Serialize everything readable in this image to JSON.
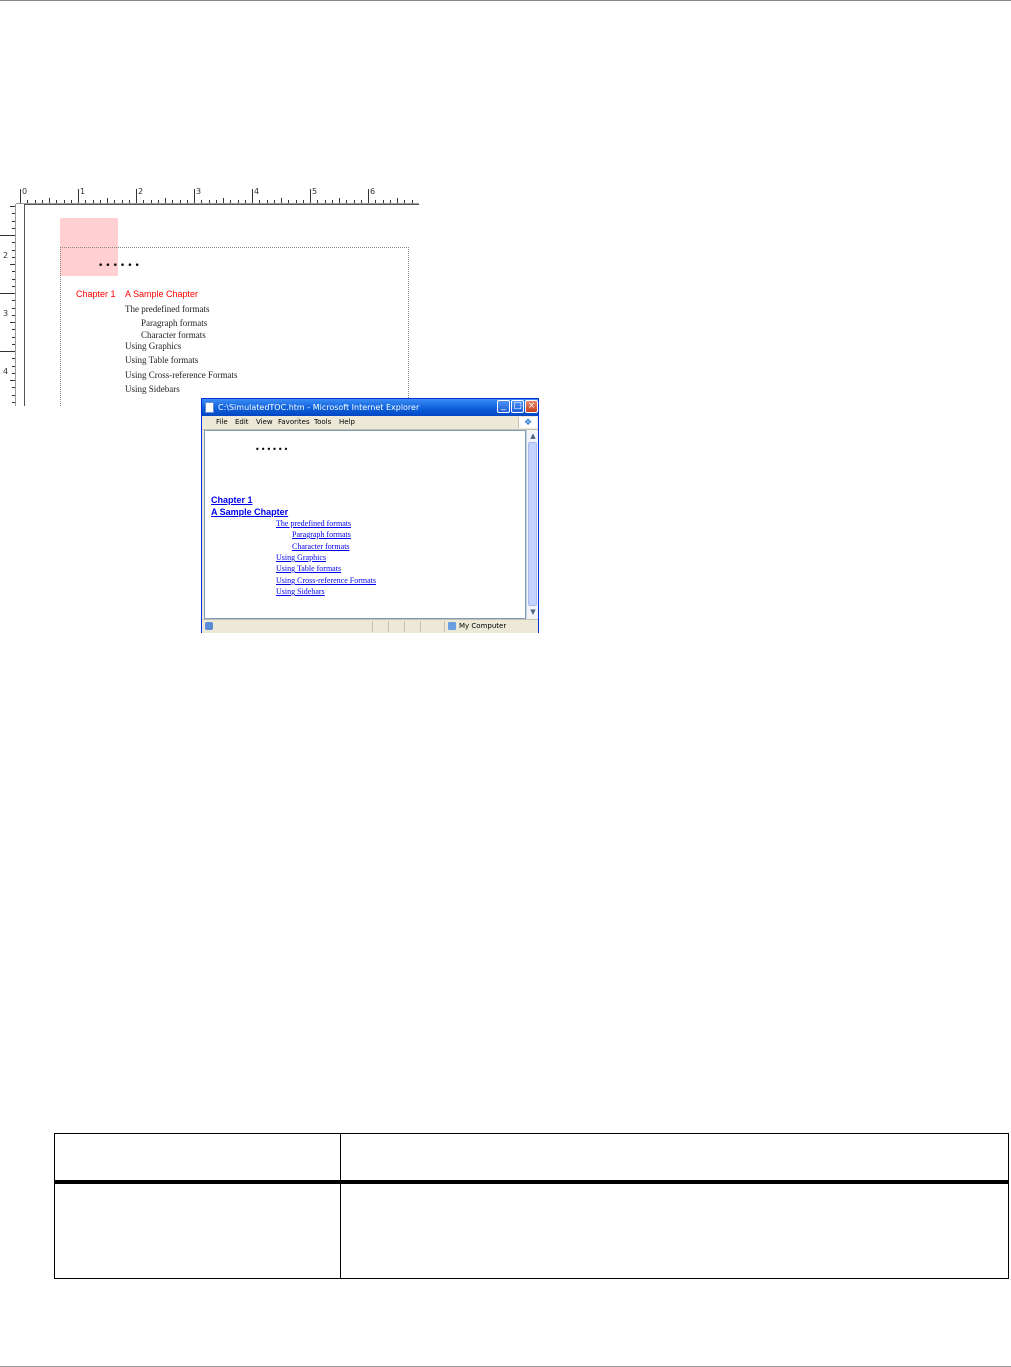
{
  "editor": {
    "ruler_h_numbers": [
      "0",
      "1",
      "2",
      "3",
      "4",
      "5",
      "6"
    ],
    "ruler_v_numbers": [
      "2",
      "3",
      "4"
    ],
    "accent_red": "#ff0000",
    "leader_dots": "••••••",
    "chapter_number": "Chapter 1",
    "chapter_title": "A Sample Chapter",
    "entries": [
      "The predefined formats",
      "Paragraph formats",
      "Character formats",
      "Using Graphics",
      "Using Table formats",
      "Using Cross-reference Formats",
      "Using Sidebars"
    ]
  },
  "browser": {
    "title": "C:\\SimulatedTOC.htm - Microsoft Internet Explorer",
    "window_buttons": {
      "minimize": "minimize-icon",
      "maximize": "maximize-icon",
      "close": "close-icon"
    },
    "menu": [
      "File",
      "Edit",
      "View",
      "Favorites",
      "Tools",
      "Help"
    ],
    "leader_dots": "••••••",
    "chapter_number": "Chapter 1",
    "chapter_title": "A Sample Chapter",
    "links": [
      "The predefined formats",
      "Paragraph formats",
      "Character formats",
      "Using Graphics",
      "Using Table formats",
      "Using Cross-reference Formats",
      "Using Sidebars"
    ],
    "status_zone": "My Computer",
    "link_color": "#0000ee",
    "title_bar_color": "#0a5cd8"
  },
  "table": {
    "header": [
      "",
      ""
    ],
    "row": [
      "",
      ""
    ]
  }
}
